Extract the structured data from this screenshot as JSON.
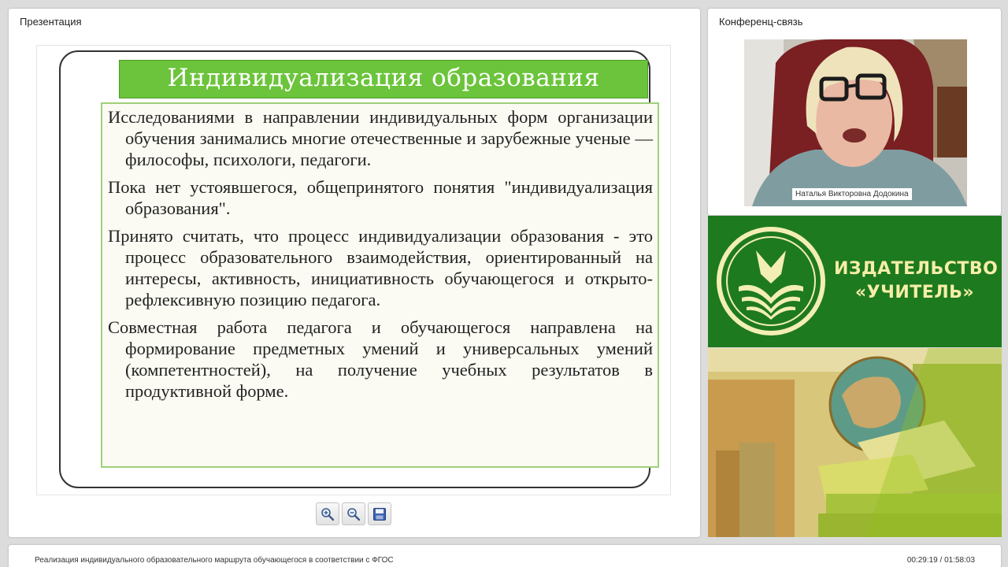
{
  "presentation": {
    "panel_title": "Презентация",
    "slide": {
      "title": "Индивидуализация образования",
      "paragraphs": [
        "Исследованиями в направлении индивидуальных форм организации обучения занимались многие отечественные и зарубежные ученые — философы, психологи, педагоги.",
        "Пока нет устоявшегося, общепринятого понятия \"индивидуализация образования\".",
        "Принято считать, что процесс индивидуализации образования - это процесс образовательного взаимодействия, ориентированный на интересы, активность, инициативность обучающегося и открыто-рефлексивную позицию педагога.",
        "Совместная работа педагога и обучающегося направлена на формирование предметных умений и универсальных умений (компетентностей), на получение учебных результатов в продуктивной форме."
      ]
    },
    "toolbar": {
      "zoom_in_icon": "zoom-in-icon",
      "zoom_out_icon": "zoom-out-icon",
      "save_icon": "floppy-disk-icon"
    }
  },
  "conference": {
    "panel_title": "Конференц-связь",
    "speaker_name": "Наталья Викторовна Додокина"
  },
  "banner": {
    "line1": "ИЗДАТЕЛЬСТВО",
    "line2": "«УЧИТЕЛЬ»",
    "colors": {
      "background": "#1e7a1e",
      "text": "#f6eea8"
    }
  },
  "footer": {
    "course_title": "Реализация индивидуального образовательного маршрута обучающегося в соответствии с ФГОС",
    "time": "00:29:19 / 01:58:03"
  },
  "colors": {
    "slide_title_bg": "#6bc43b",
    "slide_body_border": "#9fd07a",
    "page_bg": "#dcdcdc"
  }
}
